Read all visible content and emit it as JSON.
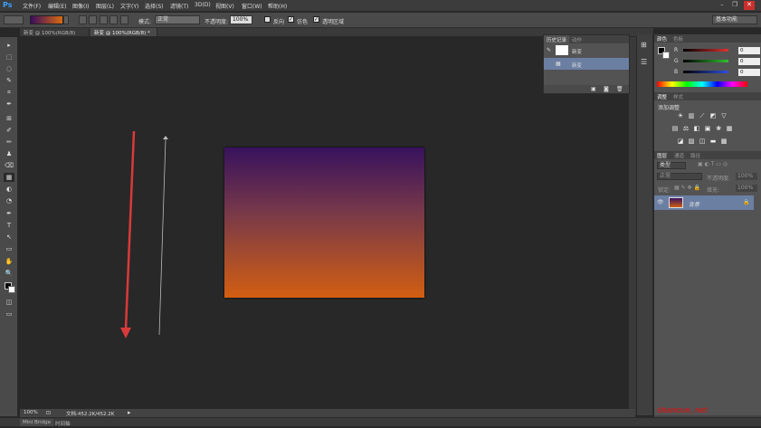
{
  "app": {
    "logo": "Ps"
  },
  "menu": [
    "文件(F)",
    "编辑(E)",
    "图像(I)",
    "图层(L)",
    "文字(Y)",
    "选择(S)",
    "滤镜(T)",
    "3D(D)",
    "视图(V)",
    "窗口(W)",
    "帮助(H)"
  ],
  "window_controls": [
    "–",
    "❐",
    "✕"
  ],
  "options": {
    "mode_label": "模式:",
    "mode_value": "正常",
    "opacity_label": "不透明度:",
    "opacity_value": "100%",
    "reverse_label": "反向",
    "dither_label": "仿色",
    "transparency_label": "透明区域",
    "workspace": "基本功能"
  },
  "tabs": [
    "新变 @ 100%(RGB/8)",
    "新变 @ 100%(RGB/8) *"
  ],
  "tools": [
    "▸",
    "⬚",
    "◌",
    "✎",
    "⌗",
    "✒",
    "⊞",
    "✐",
    "✏",
    "♟",
    "⌫",
    "▦",
    "◐",
    "◔",
    "✒",
    "T",
    "↖",
    "▭",
    "✋",
    "🔍"
  ],
  "status": {
    "zoom": "100%",
    "doc": "文档:452.2K/452.2K"
  },
  "bottom_tabs": [
    "Mini Bridge",
    "时间轴"
  ],
  "history": {
    "tabs": [
      "历史记录",
      "动作"
    ],
    "items": [
      {
        "label": "新变"
      },
      {
        "label": "新变"
      }
    ]
  },
  "color_panel": {
    "tabs": [
      "颜色",
      "色板"
    ],
    "channels": [
      {
        "name": "R",
        "value": "0",
        "color": "#e03030"
      },
      {
        "name": "G",
        "value": "0",
        "color": "#30c030"
      },
      {
        "name": "B",
        "value": "0",
        "color": "#3050e0"
      }
    ]
  },
  "adjust_panel": {
    "tabs": [
      "调整",
      "样式"
    ],
    "title": "添加调整"
  },
  "layers_panel": {
    "tabs": [
      "图层",
      "通道",
      "路径"
    ],
    "kind": "类型",
    "blend": "正常",
    "opacity_label": "不透明度:",
    "opacity_value": "100%",
    "lock_label": "锁定:",
    "fill_label": "填充:",
    "fill_value": "100%",
    "layers": [
      {
        "name": "背景"
      }
    ]
  },
  "watermark": "shancun_net"
}
